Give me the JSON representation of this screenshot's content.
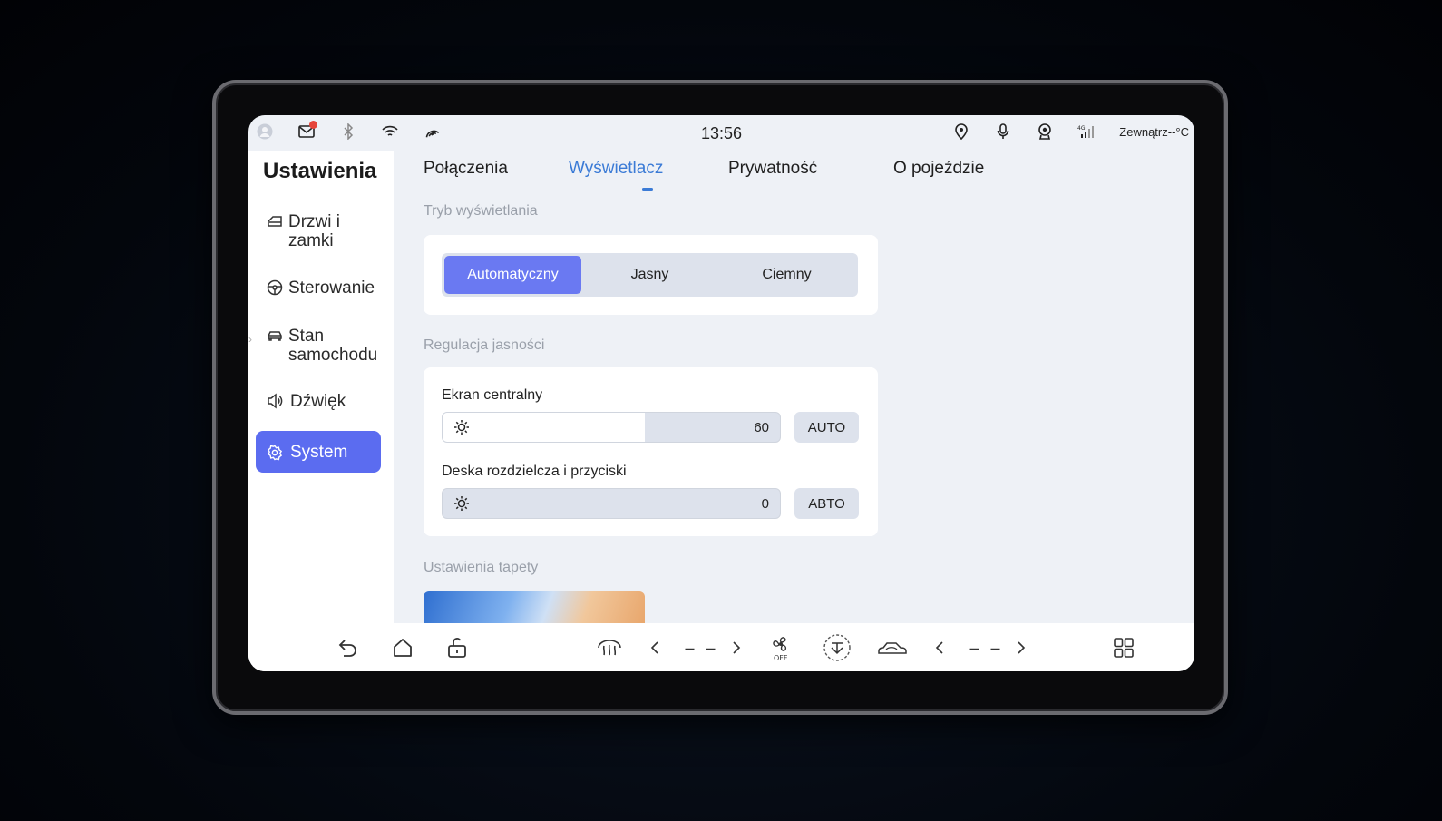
{
  "status_bar": {
    "time": "13:56",
    "outside_temp": "Zewnątrz--°C",
    "left_icons": [
      "avatar-icon",
      "mail-icon",
      "bluetooth-icon",
      "wifi-icon",
      "signal-arc-icon"
    ],
    "right_icons": [
      "location-icon",
      "microphone-icon",
      "camera-icon",
      "cellular-4g-icon"
    ]
  },
  "sidebar": {
    "title": "Ustawienia",
    "items": [
      {
        "label": "Drzwi i zamki",
        "icon": "door-icon"
      },
      {
        "label": "Sterowanie",
        "icon": "steering-wheel-icon"
      },
      {
        "label": "Stan samochodu",
        "icon": "car-icon"
      },
      {
        "label": "Dźwięk",
        "icon": "speaker-icon"
      },
      {
        "label": "System",
        "icon": "gear-icon",
        "active": true
      }
    ]
  },
  "tabs": [
    {
      "label": "Połączenia"
    },
    {
      "label": "Wyświetlacz",
      "active": true
    },
    {
      "label": "Prywatność"
    },
    {
      "label": "O pojeździe"
    }
  ],
  "display_mode": {
    "label": "Tryb wyświetlania",
    "options": [
      "Automatyczny",
      "Jasny",
      "Ciemny"
    ],
    "selected": "Automatyczny"
  },
  "brightness": {
    "label": "Regulacja jasności",
    "central": {
      "label": "Ekran centralny",
      "value": "60",
      "fraction": 0.6,
      "auto_label": "AUTO"
    },
    "dashboard": {
      "label": "Deska rozdzielcza i przyciski",
      "value": "0",
      "fraction": 0.0,
      "auto_label": "ABTO"
    }
  },
  "wallpaper": {
    "label": "Ustawienia tapety"
  },
  "dock": {
    "left_temp": "– –",
    "right_temp": "– –"
  },
  "colors": {
    "accent": "#5b6cf0",
    "tab_active": "#3b7bd6"
  }
}
